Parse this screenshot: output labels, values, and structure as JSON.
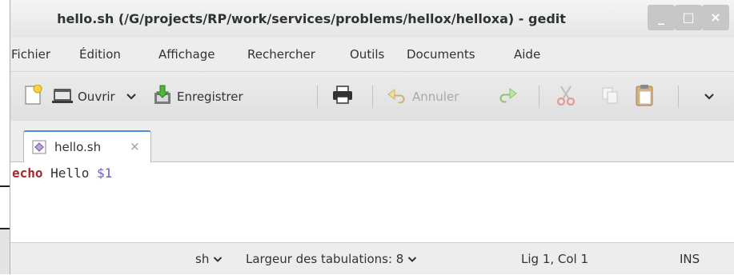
{
  "window": {
    "title": "hello.sh (/G/projects/RP/work/services/problems/hellox/helloxa) - gedit",
    "controls": {
      "minimize": "_",
      "maximize": "□",
      "close": "×"
    }
  },
  "menu": {
    "items": [
      "Fichier",
      "Édition",
      "Affichage",
      "Rechercher",
      "Outils",
      "Documents",
      "Aide"
    ]
  },
  "toolbar": {
    "open_label": "Ouvrir",
    "save_label": "Enregistrer",
    "undo_label": "Annuler",
    "icons": [
      "new-document-icon",
      "open-folder-icon",
      "chevron-down-icon",
      "save-icon",
      "print-icon",
      "undo-icon",
      "redo-icon",
      "cut-icon",
      "copy-icon",
      "paste-icon",
      "overflow-chevron-icon"
    ]
  },
  "tabs": [
    {
      "label": "hello.sh",
      "close": "×"
    }
  ],
  "editor": {
    "lines": [
      {
        "keyword": "echo",
        "text": " Hello ",
        "variable": "$1"
      }
    ]
  },
  "status": {
    "language": "sh",
    "tab_width": "Largeur des tabulations:  8",
    "position": "Lig 1, Col 1",
    "mode": "INS"
  },
  "colors": {
    "keyword": "#a52a2a",
    "variable": "#6a5acd",
    "tab_accent": "#4a90d9"
  }
}
